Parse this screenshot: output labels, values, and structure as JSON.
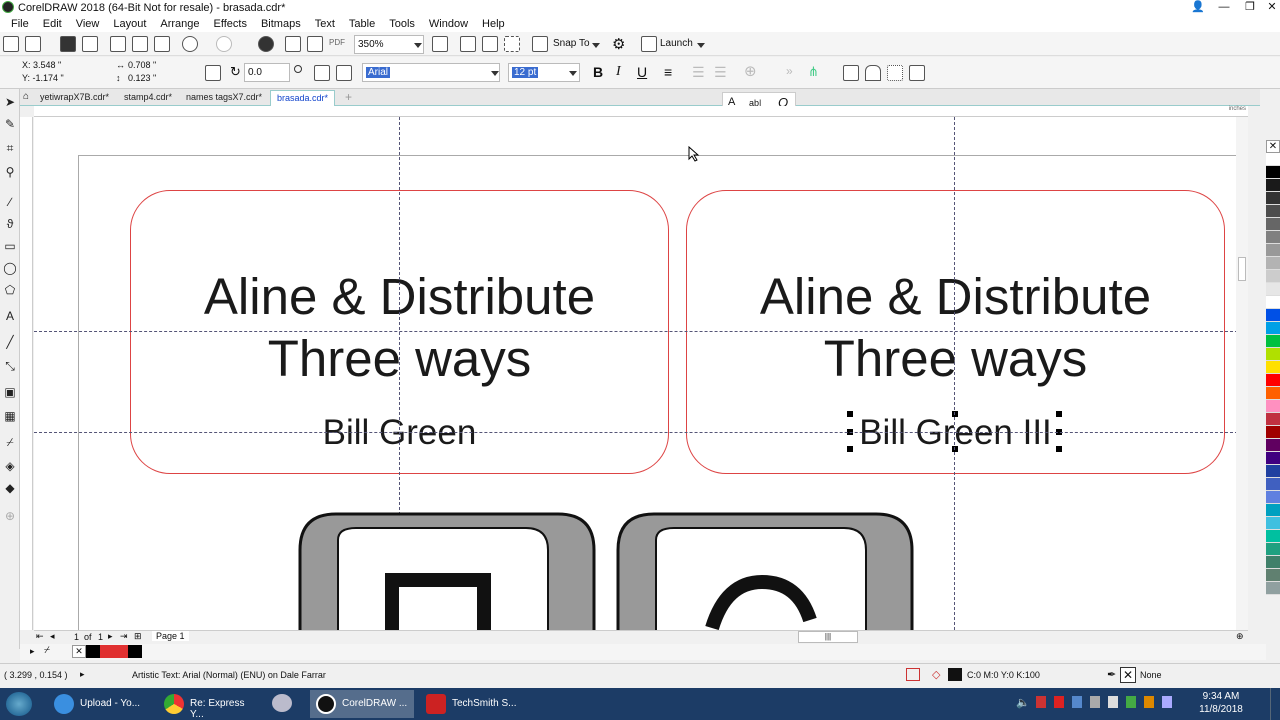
{
  "window": {
    "title": "CorelDRAW 2018 (64-Bit Not for resale) - brasada.cdr*"
  },
  "menu": [
    "File",
    "Edit",
    "View",
    "Layout",
    "Arrange",
    "Effects",
    "Bitmaps",
    "Text",
    "Table",
    "Tools",
    "Window",
    "Help"
  ],
  "toolbar": {
    "zoom": "350%",
    "snap_to": "Snap To",
    "launch": "Launch",
    "pdf": "PDF"
  },
  "property_bar": {
    "x": "X: 3.548 \"",
    "y": "Y: -1.174 \"",
    "w": "0.708 \"",
    "h": "0.123 \"",
    "angle": "0.0",
    "font": "Arial",
    "size": "12 pt",
    "bold": "B",
    "italic": "I",
    "underline": "U"
  },
  "text_tools": {
    "a": "A",
    "ab": "ab|",
    "o": "O"
  },
  "tabs": [
    "yetiwrapX7B.cdr*",
    "stamp4.cdr*",
    "names tagsX7.cdr*",
    "brasada.cdr*"
  ],
  "ruler_label": "inches",
  "cards": [
    {
      "line1": "Aline & Distribute",
      "line2": "Three ways",
      "name": "Bill Green"
    },
    {
      "line1": "Aline & Distribute",
      "line2": "Three ways",
      "name": "Bill Green III"
    }
  ],
  "page_nav": {
    "current": "1",
    "of": "of",
    "total": "1",
    "page_tab": "Page 1"
  },
  "status": {
    "coords": "( 3.299 , 0.154 )",
    "object": "Artistic Text: Arial (Normal) (ENU) on Dale Farrar",
    "fill": "C:0 M:0 Y:0 K:100",
    "outline": "None"
  },
  "taskbar": {
    "items": [
      "Upload - Yo...",
      "Re: Express Y...",
      "CorelDRAW ...",
      "TechSmith S..."
    ],
    "time": "9:34 AM",
    "date": "11/8/2018"
  },
  "palette": [
    "#ffffff",
    "#000000",
    "#1a1a1a",
    "#333333",
    "#4d4d4d",
    "#666666",
    "#808080",
    "#999999",
    "#b3b3b3",
    "#cccccc",
    "#e6e6e6",
    "#ffffff",
    "#0050e6",
    "#00a0e6",
    "#00c040",
    "#b0e000",
    "#ffe000",
    "#ff0000",
    "#ff6000",
    "#ff90c0",
    "#c03040",
    "#a00000",
    "#600060",
    "#400080",
    "#2040a0",
    "#4060c0",
    "#6080e0",
    "#00a0c0",
    "#40c0e0",
    "#00c0a0",
    "#20a080",
    "#40806a",
    "#608070",
    "#90a0a0"
  ]
}
